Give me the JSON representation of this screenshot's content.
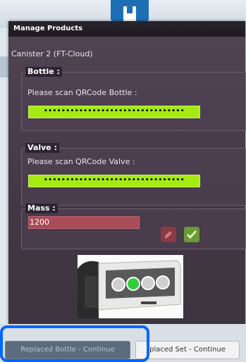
{
  "dialog": {
    "title": "Manage Products",
    "canister_label": "Canister 2 (FT-Cloud)"
  },
  "bottle": {
    "legend": "Bottle :",
    "prompt": "Please scan QRCode Bottle :",
    "value": "••••••••••••••••••••••••••••••••"
  },
  "valve": {
    "legend": "Valve :",
    "prompt": "Please scan QRCode Valve :",
    "value": "••••••••••••••••••••••••••••••••"
  },
  "mass": {
    "legend": "Mass :",
    "value": "1200"
  },
  "buttons": {
    "replaced_bottle": "Replaced Bottle - Continue",
    "replaced_set": "placed Set - Continue"
  },
  "colors": {
    "scan_fill": "#a6ea13",
    "mass_fill": "#a94c58",
    "highlight": "#0066ff"
  },
  "icons": {
    "edit": "pencil-icon",
    "confirm": "checkmark-icon"
  }
}
